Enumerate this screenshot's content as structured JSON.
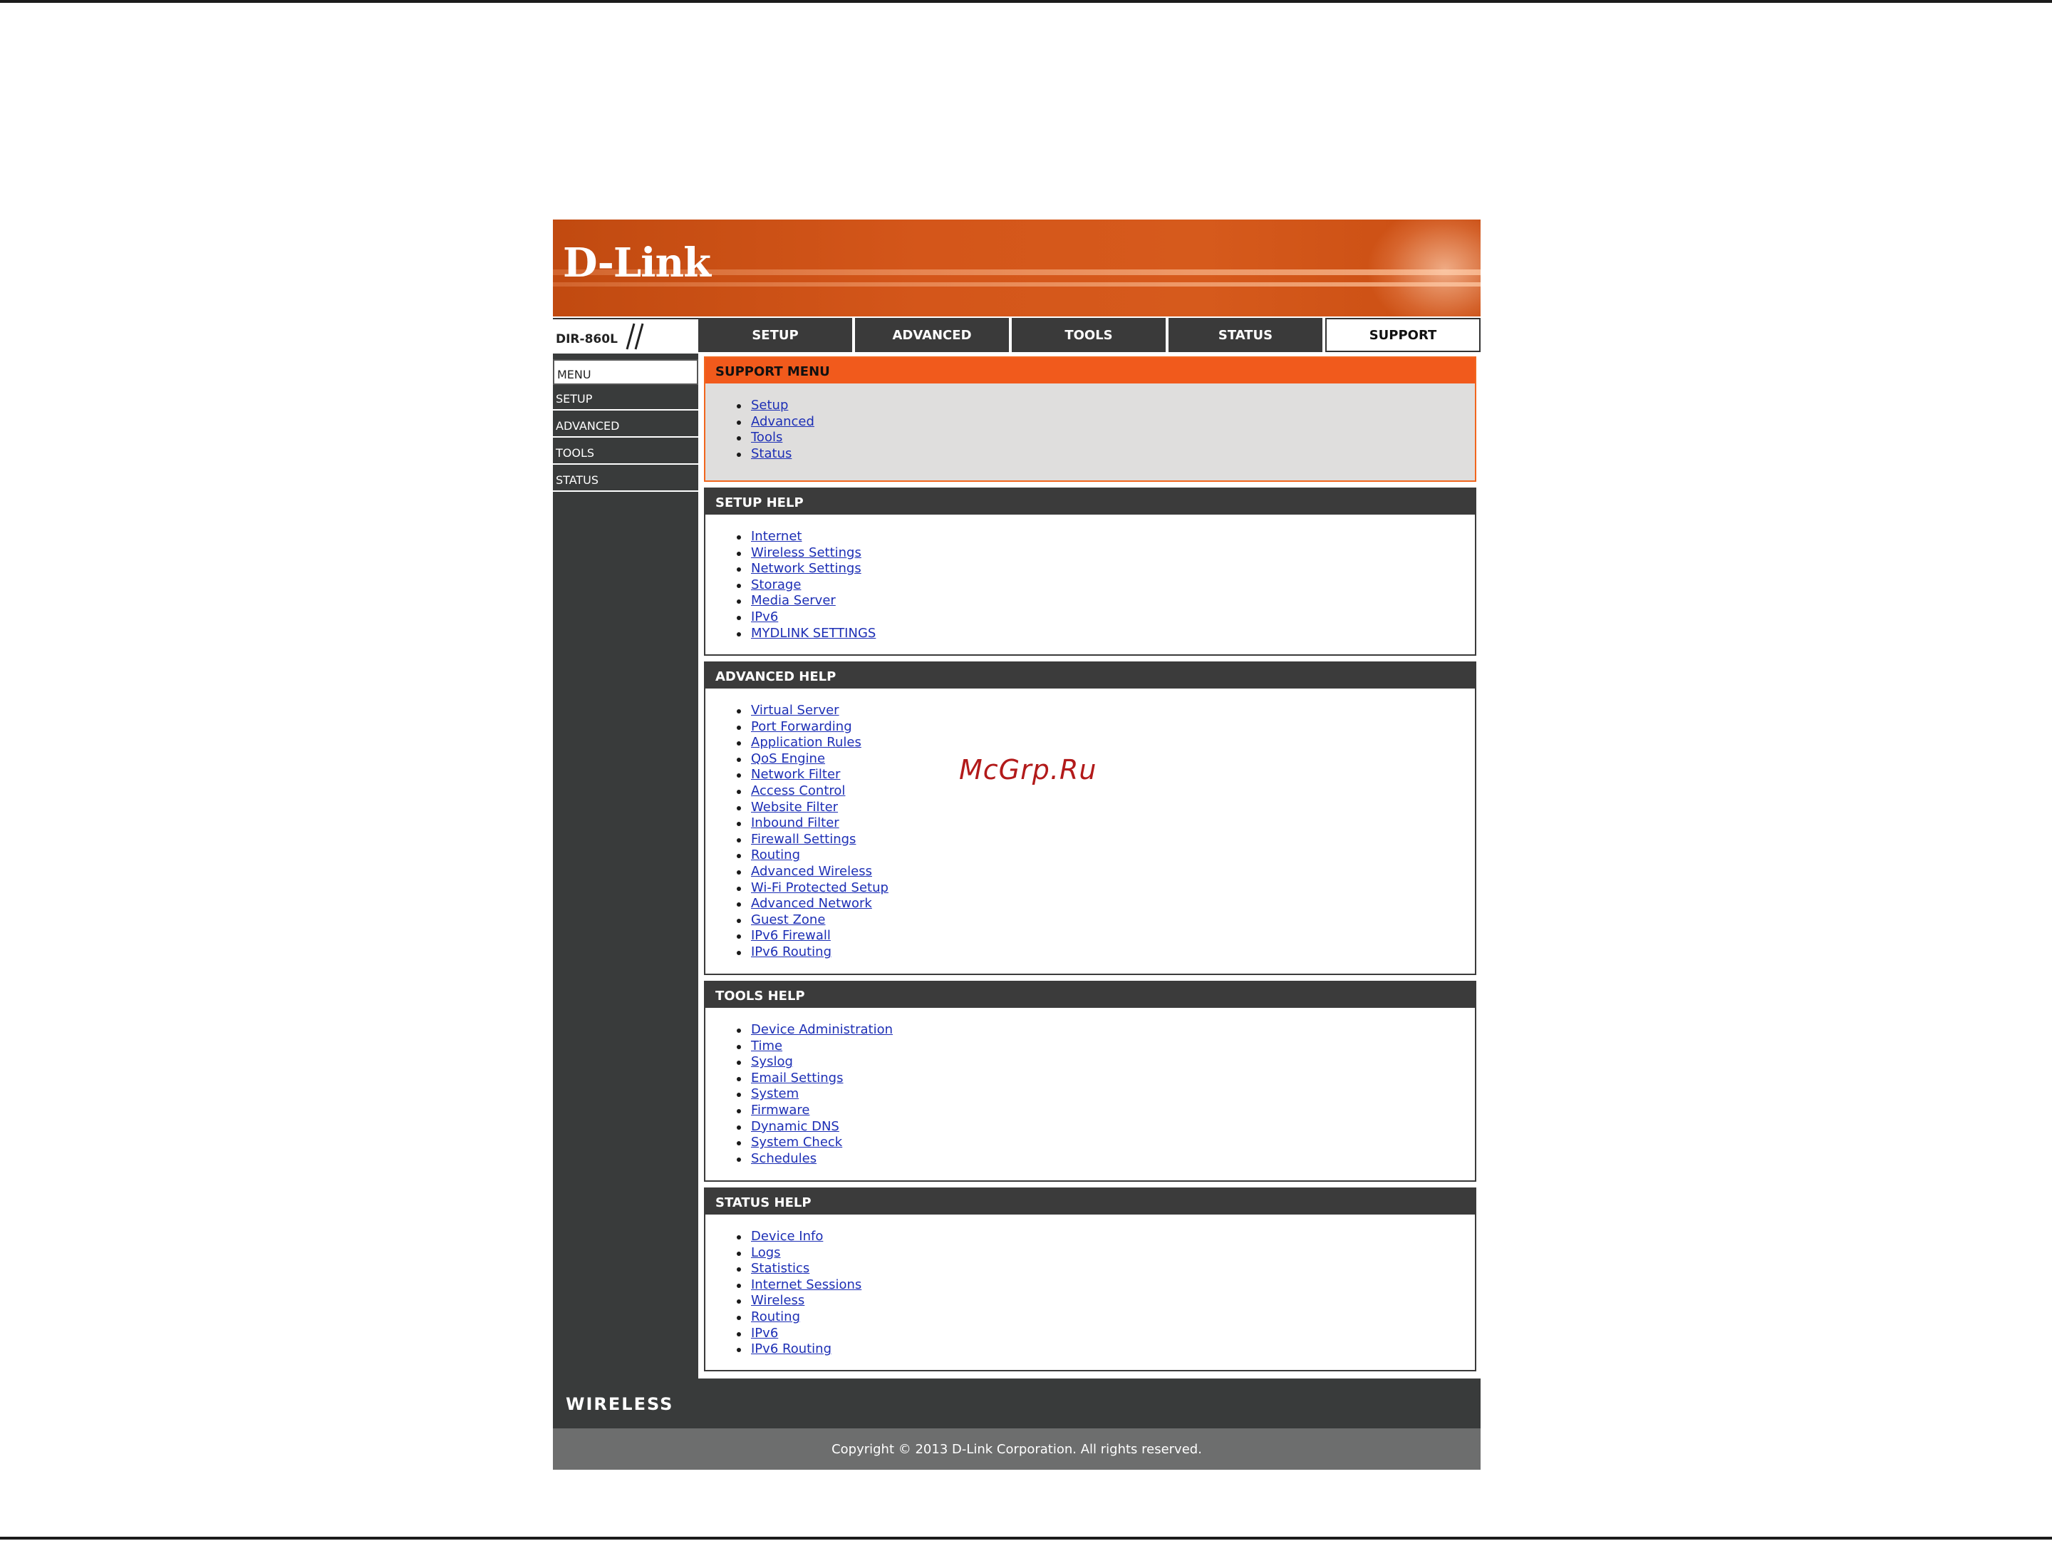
{
  "brand": {
    "logo_text": "D-Link",
    "model": "DIR-860L"
  },
  "nav": {
    "tabs": [
      {
        "label": "SETUP"
      },
      {
        "label": "ADVANCED"
      },
      {
        "label": "TOOLS"
      },
      {
        "label": "STATUS"
      },
      {
        "label": "SUPPORT"
      }
    ],
    "active_tab": "SUPPORT"
  },
  "sidebar": {
    "items": [
      {
        "label": "MENU"
      },
      {
        "label": "SETUP"
      },
      {
        "label": "ADVANCED"
      },
      {
        "label": "TOOLS"
      },
      {
        "label": "STATUS"
      }
    ],
    "active_item": "MENU"
  },
  "sections": {
    "support_menu": {
      "title": "SUPPORT MENU",
      "links": [
        "Setup",
        "Advanced",
        "Tools",
        "Status"
      ]
    },
    "setup_help": {
      "title": "SETUP HELP",
      "links": [
        "Internet",
        "Wireless Settings",
        "Network Settings",
        "Storage",
        "Media Server",
        "IPv6",
        "MYDLINK SETTINGS"
      ]
    },
    "advanced_help": {
      "title": "ADVANCED HELP",
      "links": [
        "Virtual Server",
        "Port Forwarding",
        "Application Rules",
        "QoS Engine",
        "Network Filter",
        "Access Control",
        "Website Filter",
        "Inbound Filter",
        "Firewall Settings",
        "Routing",
        "Advanced Wireless",
        "Wi-Fi Protected Setup",
        "Advanced Network",
        "Guest Zone",
        "IPv6 Firewall",
        "IPv6 Routing"
      ]
    },
    "tools_help": {
      "title": "TOOLS HELP",
      "links": [
        "Device Administration",
        "Time",
        "Syslog",
        "Email Settings",
        "System",
        "Firmware",
        "Dynamic DNS",
        "System Check",
        "Schedules"
      ]
    },
    "status_help": {
      "title": "STATUS HELP",
      "links": [
        "Device Info",
        "Logs",
        "Statistics",
        "Internet Sessions",
        "Wireless",
        "Routing",
        "IPv6",
        "IPv6 Routing"
      ]
    }
  },
  "footer": {
    "wireless_label": "WIRELESS",
    "copyright": "Copyright © 2013 D-Link Corporation. All rights reserved."
  },
  "watermark": "McGrp.Ru",
  "colors": {
    "banner_orange": "#d4561a",
    "support_header_orange": "#f15a1c",
    "dark_bar": "#3b3b3b",
    "link_blue": "#1d2fb5"
  }
}
